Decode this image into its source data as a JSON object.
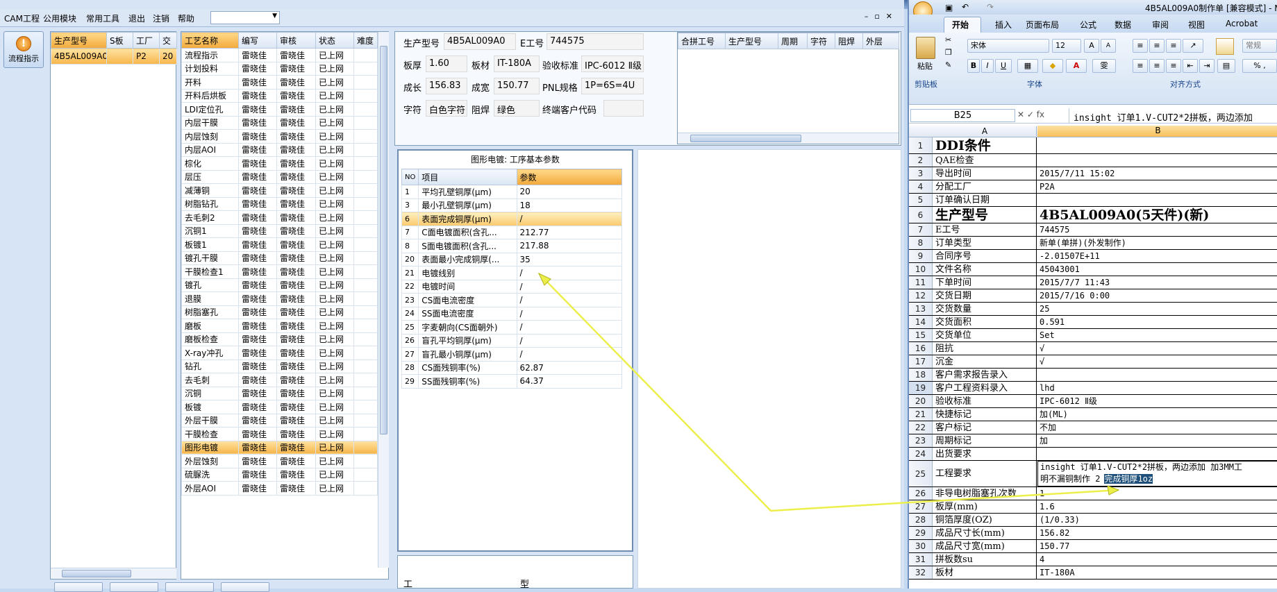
{
  "menu": {
    "items": [
      "CAM工程",
      "公用模块",
      "常用工具",
      "退出",
      "注销",
      "帮助"
    ]
  },
  "sidebar": {
    "flow_button": "流程指示"
  },
  "order_list": {
    "headers": [
      "生产型号",
      "S板",
      "工厂",
      "交"
    ],
    "rows": [
      [
        "4B5AL009A0",
        "",
        "P2",
        "20"
      ]
    ]
  },
  "process_list": {
    "headers": [
      "工艺名称",
      "编写",
      "审核",
      "状态",
      "难度"
    ],
    "rows": [
      [
        "流程指示",
        "雷晓佳",
        "雷晓佳",
        "已上网",
        ""
      ],
      [
        "计划投料",
        "雷晓佳",
        "雷晓佳",
        "已上网",
        ""
      ],
      [
        "开料",
        "雷晓佳",
        "雷晓佳",
        "已上网",
        ""
      ],
      [
        "开料后烘板",
        "雷晓佳",
        "雷晓佳",
        "已上网",
        ""
      ],
      [
        "LDI定位孔",
        "雷晓佳",
        "雷晓佳",
        "已上网",
        ""
      ],
      [
        "内层干膜",
        "雷晓佳",
        "雷晓佳",
        "已上网",
        ""
      ],
      [
        "内层蚀刻",
        "雷晓佳",
        "雷晓佳",
        "已上网",
        ""
      ],
      [
        "内层AOI",
        "雷晓佳",
        "雷晓佳",
        "已上网",
        ""
      ],
      [
        "棕化",
        "雷晓佳",
        "雷晓佳",
        "已上网",
        ""
      ],
      [
        "层压",
        "雷晓佳",
        "雷晓佳",
        "已上网",
        ""
      ],
      [
        "减薄铜",
        "雷晓佳",
        "雷晓佳",
        "已上网",
        ""
      ],
      [
        "树脂钻孔",
        "雷晓佳",
        "雷晓佳",
        "已上网",
        ""
      ],
      [
        "去毛刺2",
        "雷晓佳",
        "雷晓佳",
        "已上网",
        ""
      ],
      [
        "沉铜1",
        "雷晓佳",
        "雷晓佳",
        "已上网",
        ""
      ],
      [
        "板镀1",
        "雷晓佳",
        "雷晓佳",
        "已上网",
        ""
      ],
      [
        "镀孔干膜",
        "雷晓佳",
        "雷晓佳",
        "已上网",
        ""
      ],
      [
        "干膜检查1",
        "雷晓佳",
        "雷晓佳",
        "已上网",
        ""
      ],
      [
        "镀孔",
        "雷晓佳",
        "雷晓佳",
        "已上网",
        ""
      ],
      [
        "退膜",
        "雷晓佳",
        "雷晓佳",
        "已上网",
        ""
      ],
      [
        "树脂塞孔",
        "雷晓佳",
        "雷晓佳",
        "已上网",
        ""
      ],
      [
        "磨板",
        "雷晓佳",
        "雷晓佳",
        "已上网",
        ""
      ],
      [
        "磨板检查",
        "雷晓佳",
        "雷晓佳",
        "已上网",
        ""
      ],
      [
        "X-ray冲孔",
        "雷晓佳",
        "雷晓佳",
        "已上网",
        ""
      ],
      [
        "钻孔",
        "雷晓佳",
        "雷晓佳",
        "已上网",
        ""
      ],
      [
        "去毛刺",
        "雷晓佳",
        "雷晓佳",
        "已上网",
        ""
      ],
      [
        "沉铜",
        "雷晓佳",
        "雷晓佳",
        "已上网",
        ""
      ],
      [
        "板镀",
        "雷晓佳",
        "雷晓佳",
        "已上网",
        ""
      ],
      [
        "外层干膜",
        "雷晓佳",
        "雷晓佳",
        "已上网",
        ""
      ],
      [
        "干膜检查",
        "雷晓佳",
        "雷晓佳",
        "已上网",
        ""
      ],
      [
        "图形电镀",
        "雷晓佳",
        "雷晓佳",
        "已上网",
        ""
      ],
      [
        "外层蚀刻",
        "雷晓佳",
        "雷晓佳",
        "已上网",
        ""
      ],
      [
        "硫脲洗",
        "雷晓佳",
        "雷晓佳",
        "已上网",
        ""
      ],
      [
        "外层AOI",
        "雷晓佳",
        "雷晓佳",
        "已上网",
        ""
      ]
    ],
    "selected": "图形电镀"
  },
  "info": {
    "model_label": "生产型号",
    "model_value": "4B5AL009A0",
    "e_label": "E工号",
    "e_value": "744575",
    "thick_label": "板厚",
    "thick_value": "1.60",
    "mat_label": "板材",
    "mat_value": "IT-180A",
    "std_label": "验收标准",
    "std_value": "IPC-6012 Ⅱ级",
    "len_label": "成长",
    "len_value": "156.83",
    "wid_label": "成宽",
    "wid_value": "150.77",
    "pnl_label": "PNL规格",
    "pnl_value": "1P=6S=4U",
    "char_label": "字符",
    "char_value": "白色字符",
    "mask_label": "阻焊",
    "mask_value": "绿色",
    "cust_label": "终端客户代码",
    "cust_value": ""
  },
  "merge_table": {
    "headers": [
      "合拼工号",
      "生产型号",
      "周期",
      "字符",
      "阻焊",
      "外层"
    ]
  },
  "params": {
    "title": "图形电镀: 工序基本参数",
    "headers": [
      "NO",
      "项目",
      "参数"
    ],
    "rows": [
      [
        "1",
        "平均孔壁铜厚(μm)",
        "20"
      ],
      [
        "3",
        "最小孔壁铜厚(μm)",
        "18"
      ],
      [
        "6",
        "表面完成铜厚(μm)",
        "/"
      ],
      [
        "7",
        "C面电镀面积(含孔...",
        "212.77"
      ],
      [
        "8",
        "S面电镀面积(含孔...",
        "217.88"
      ],
      [
        "20",
        "表面最小完成铜厚(...",
        "35"
      ],
      [
        "21",
        "电镀线别",
        "/"
      ],
      [
        "22",
        "电镀时间",
        "/"
      ],
      [
        "23",
        "CS面电流密度",
        "/"
      ],
      [
        "24",
        "SS面电流密度",
        "/"
      ],
      [
        "25",
        "字麦朝向(CS面朝外)",
        "/"
      ],
      [
        "26",
        "盲孔平均铜厚(μm)",
        "/"
      ],
      [
        "27",
        "盲孔最小铜厚(μm)",
        "/"
      ],
      [
        "28",
        "CS面残铜率(%)",
        "62.87"
      ],
      [
        "29",
        "SS面残铜率(%)",
        "64.37"
      ]
    ],
    "highlight_row": "6"
  },
  "lower_labels": {
    "a": "工",
    "b": "型"
  },
  "excel": {
    "title": "4B5AL009A0制作单 [兼容模式] - M",
    "tabs": [
      "开始",
      "插入",
      "页面布局",
      "公式",
      "数据",
      "审阅",
      "视图",
      "Acrobat"
    ],
    "paste": "粘贴",
    "font_name": "宋体",
    "font_size": "12",
    "number_fmt": "常规",
    "groups": [
      "剪贴板",
      "字体",
      "对齐方式"
    ],
    "name_box": "B25",
    "formula": "insight 订单1.V-CUT2*2拼板，两边添加",
    "col_a": "A",
    "col_b": "B",
    "rows": [
      {
        "n": "1",
        "a": "DDI条件",
        "b": "",
        "big": true
      },
      {
        "n": "2",
        "a": "QAE检查",
        "b": ""
      },
      {
        "n": "3",
        "a": "导出时间",
        "b": "2015/7/11 15:02"
      },
      {
        "n": "4",
        "a": "分配工厂",
        "b": "P2A"
      },
      {
        "n": "5",
        "a": "订单确认日期",
        "b": ""
      },
      {
        "n": "6",
        "a": "生产型号",
        "b": "4B5AL009A0(5天件)(新)",
        "big": true
      },
      {
        "n": "7",
        "a": "E工号",
        "b": "744575"
      },
      {
        "n": "8",
        "a": "订单类型",
        "b": "新单(单拼)(外发制作)"
      },
      {
        "n": "9",
        "a": "合同序号",
        "b": "-2.01507E+11"
      },
      {
        "n": "10",
        "a": "文件名称",
        "b": "45043001"
      },
      {
        "n": "11",
        "a": "下单时间",
        "b": "2015/7/7 11:43"
      },
      {
        "n": "12",
        "a": "交货日期",
        "b": "2015/7/16 0:00"
      },
      {
        "n": "13",
        "a": "交货数量",
        "b": "25"
      },
      {
        "n": "14",
        "a": "交货面积",
        "b": "0.591"
      },
      {
        "n": "15",
        "a": "交货单位",
        "b": "Set"
      },
      {
        "n": "16",
        "a": "阻抗",
        "b": "√"
      },
      {
        "n": "17",
        "a": "沉金",
        "b": "√"
      },
      {
        "n": "18",
        "a": "客户需求报告录入",
        "b": ""
      },
      {
        "n": "19",
        "a": "客户工程资料录入",
        "b": "lhd"
      },
      {
        "n": "20",
        "a": "验收标准",
        "b": "IPC-6012 Ⅱ级"
      },
      {
        "n": "21",
        "a": "快捷标记",
        "b": "加(ML)"
      },
      {
        "n": "22",
        "a": "客户标记",
        "b": "不加"
      },
      {
        "n": "23",
        "a": "周期标记",
        "b": "加"
      },
      {
        "n": "24",
        "a": "出货要求",
        "b": ""
      },
      {
        "n": "25",
        "a": "工程要求",
        "b": "insight 订单1.V-CUT2*2拼板，两边添加 加3MM工",
        "b2": "明不漏铜制作 2",
        "b3": "完成铜厚1oz"
      },
      {
        "n": "26",
        "a": "非导电树脂塞孔次数",
        "b": "1"
      },
      {
        "n": "27",
        "a": "板厚(mm)",
        "b": "1.6"
      },
      {
        "n": "28",
        "a": "铜箔厚度(OZ)",
        "b": "(1/0.33)"
      },
      {
        "n": "29",
        "a": "成品尺寸长(mm)",
        "b": "156.82"
      },
      {
        "n": "30",
        "a": "成品尺寸宽(mm)",
        "b": "150.77"
      },
      {
        "n": "31",
        "a": "拼板数su",
        "b": "4"
      },
      {
        "n": "32",
        "a": "板材",
        "b": "IT-180A"
      }
    ]
  },
  "colors": {
    "arrow": "#ecef4a",
    "selected": "#f7b64b",
    "excel_highlight": "#1d4f7a"
  }
}
